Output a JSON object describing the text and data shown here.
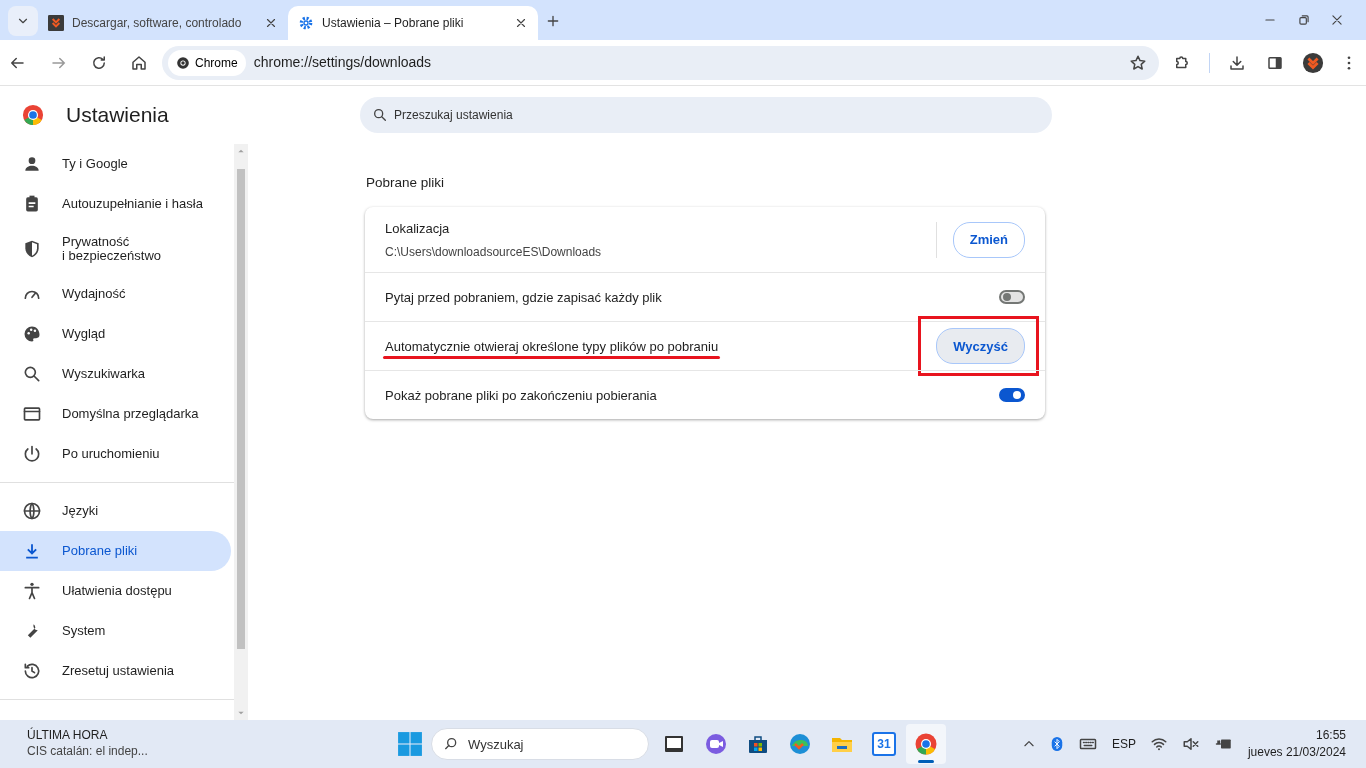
{
  "tabs": [
    {
      "title": "Descargar, software, controlado",
      "selected": false
    },
    {
      "title": "Ustawienia – Pobrane pliki",
      "selected": true
    }
  ],
  "address_bar": {
    "chip": "Chrome",
    "url": "chrome://settings/downloads"
  },
  "sidebar": {
    "title": "Ustawienia",
    "sections": [
      {
        "items": [
          {
            "label": "Ty i Google",
            "selected": false
          },
          {
            "label": "Autouzupełnianie i hasła",
            "selected": false
          },
          {
            "label": "Prywatność\ni bezpieczeństwo",
            "selected": false
          },
          {
            "label": "Wydajność",
            "selected": false
          },
          {
            "label": "Wygląd",
            "selected": false
          },
          {
            "label": "Wyszukiwarka",
            "selected": false
          },
          {
            "label": "Domyślna przeglądarka",
            "selected": false
          },
          {
            "label": "Po uruchomieniu",
            "selected": false
          }
        ]
      },
      {
        "items": [
          {
            "label": "Języki",
            "selected": false
          },
          {
            "label": "Pobrane pliki",
            "selected": true
          },
          {
            "label": "Ułatwienia dostępu",
            "selected": false
          },
          {
            "label": "System",
            "selected": false
          },
          {
            "label": "Zresetuj ustawienia",
            "selected": false
          }
        ]
      }
    ]
  },
  "search": {
    "placeholder": "Przeszukaj ustawienia"
  },
  "section_title": "Pobrane pliki",
  "rows": [
    {
      "kind": "location",
      "label": "Lokalizacja",
      "value": "C:\\Users\\downloadsourceES\\Downloads",
      "button": "Zmień"
    },
    {
      "kind": "toggle",
      "label": "Pytaj przed pobraniem, gdzie zapisać każdy plik",
      "on": false
    },
    {
      "kind": "action",
      "label": "Automatycznie otwieraj określone typy plików po pobraniu",
      "button": "Wyczyść",
      "underlined": true,
      "boxed": true
    },
    {
      "kind": "toggle",
      "label": "Pokaż pobrane pliki po zakończeniu pobierania",
      "on": true
    }
  ],
  "taskbar": {
    "news_title": "ÚLTIMA HORA",
    "news_text": "CIS catalán: el indep...",
    "search_placeholder": "Wyszukaj",
    "apps": [
      {
        "selected": false
      },
      {
        "selected": false
      },
      {
        "selected": false
      },
      {
        "selected": false
      },
      {
        "selected": false
      },
      {
        "selected": false
      },
      {
        "selected": true
      }
    ],
    "calendar_day": "31",
    "language": "ESP",
    "time": "16:55",
    "date": "jueves 21/03/2024"
  }
}
